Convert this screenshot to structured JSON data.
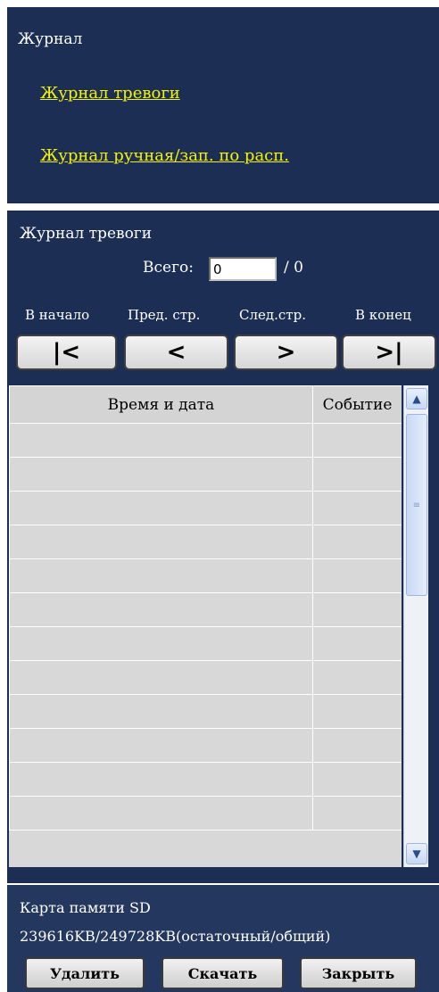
{
  "log_section": {
    "title": "Журнал",
    "links": [
      "Журнал тревоги",
      "Журнал ручная/зап. по расп."
    ]
  },
  "alarm_log": {
    "title": "Журнал тревоги",
    "total_label": "Всего:",
    "total_value": "0",
    "total_suffix": "/ 0",
    "nav_labels": {
      "first": "В начало",
      "prev": "Пред. стр.",
      "next": "След.стр.",
      "last": "В конец"
    },
    "nav_icons": {
      "first": "first-page-icon",
      "prev": "prev-page-icon",
      "next": "next-page-icon",
      "last": "last-page-icon"
    },
    "table": {
      "headers": [
        "Время и дата",
        "Событие"
      ],
      "rows": 12
    }
  },
  "sd_card": {
    "title": "Карта памяти SD",
    "capacity": "239616KB/249728KB(остаточный/общий)"
  },
  "actions": {
    "delete": "Удалить",
    "download": "Скачать",
    "close": "Закрыть"
  },
  "colors": {
    "panel": "#1d2e55",
    "link": "#f2f20a",
    "table_bg": "#d8d8d8"
  }
}
